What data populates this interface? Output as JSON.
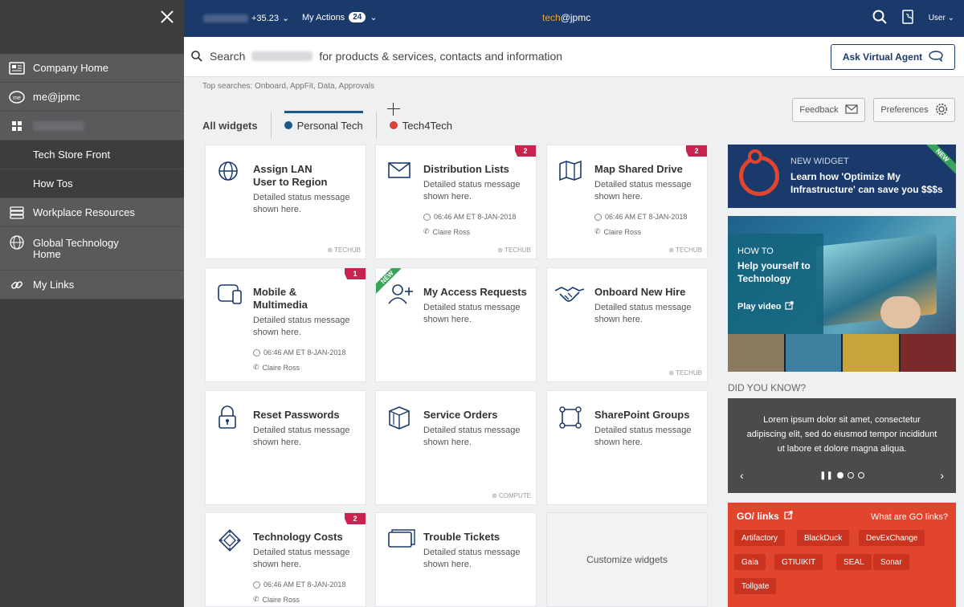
{
  "sidebar": {
    "items": [
      {
        "label": "Company Home",
        "icon": "home-icon"
      },
      {
        "label": "me@jpmc",
        "icon": "me-icon"
      },
      {
        "label": "",
        "icon": "grid-icon"
      },
      {
        "label": "Tech Store Front"
      },
      {
        "label": "How Tos"
      },
      {
        "label": "Workplace Resources",
        "icon": "stack-icon"
      },
      {
        "label": "Global Technology Home",
        "icon": "globe-icon"
      },
      {
        "label": "My Links",
        "icon": "link-icon"
      }
    ]
  },
  "topbar": {
    "stock_change": "+35.23",
    "actions_label": "My Actions",
    "actions_count": "24",
    "brand_prefix": "tech",
    "brand_suffix": "@jpmc",
    "user_label": "User"
  },
  "search": {
    "prefix": "Search",
    "suffix": "for products & services, contacts and information",
    "ask_label": "Ask Virtual Agent",
    "top_searches": "Top searches: Onboard, AppFit, Data, Approvals"
  },
  "buttons": {
    "feedback": "Feedback",
    "preferences": "Preferences"
  },
  "tabs": {
    "all": "All widgets",
    "personal": "Personal Tech",
    "tech4tech": "Tech4Tech"
  },
  "colors": {
    "navy": "#1a3a6b",
    "accent_orange": "#f2a42a",
    "badge_red": "#c8234f",
    "new_green": "#3aa35a",
    "go_red": "#e2452e",
    "personal_dot": "#1a5a8a",
    "tech4tech_dot": "#d9433a"
  },
  "widgets": {
    "status": "Detailed status message shown here.",
    "time": "06:46 AM ET 8-JAN-2018",
    "person": "Claire Ross",
    "logo_techub": "TECHUB",
    "logo_compute": "COMPUTE",
    "items": [
      {
        "title": "Assign LAN User to Region",
        "icon": "globe-icon"
      },
      {
        "title": "Distribution Lists",
        "icon": "mail-icon",
        "badge": "2"
      },
      {
        "title": "Map Shared Drive",
        "icon": "map-icon",
        "badge": "2"
      },
      {
        "title": "Mobile & Multimedia",
        "icon": "mobile-icon",
        "badge": "1"
      },
      {
        "title": "My Access Requests",
        "icon": "user-plus-icon",
        "ribbon": "NEW"
      },
      {
        "title": "Onboard New Hire",
        "icon": "handshake-icon"
      },
      {
        "title": "Reset Passwords",
        "icon": "lock-icon"
      },
      {
        "title": "Service Orders",
        "icon": "box-icon"
      },
      {
        "title": "SharePoint Groups",
        "icon": "group-icon"
      },
      {
        "title": "Technology Costs",
        "icon": "chip-icon",
        "badge": "2"
      },
      {
        "title": "Trouble Tickets",
        "icon": "ticket-icon"
      }
    ],
    "customize": "Customize widgets"
  },
  "rail": {
    "new_widget": {
      "tag": "NEW WIDGET",
      "msg": "Learn how 'Optimize My Infrastructure' can save you $$$s",
      "corner": "NEW"
    },
    "howto": {
      "kicker": "HOW TO",
      "title": "Help yourself to Technology",
      "play": "Play video"
    },
    "dyk_label": "DID YOU KNOW?",
    "dyk_text": "Lorem ipsum dolor sit amet, consectetur adipiscing elit, sed do eiusmod tempor incididunt ut labore et dolore magna aliqua.",
    "golinks": {
      "title": "GO/ links",
      "what": "What are GO links?",
      "chips": [
        "Artifactory",
        "BlackDuck",
        "DevExChange",
        "Gaia",
        "GTIUIKIT",
        "SEAL",
        "Sonar",
        "Tollgate"
      ]
    }
  }
}
